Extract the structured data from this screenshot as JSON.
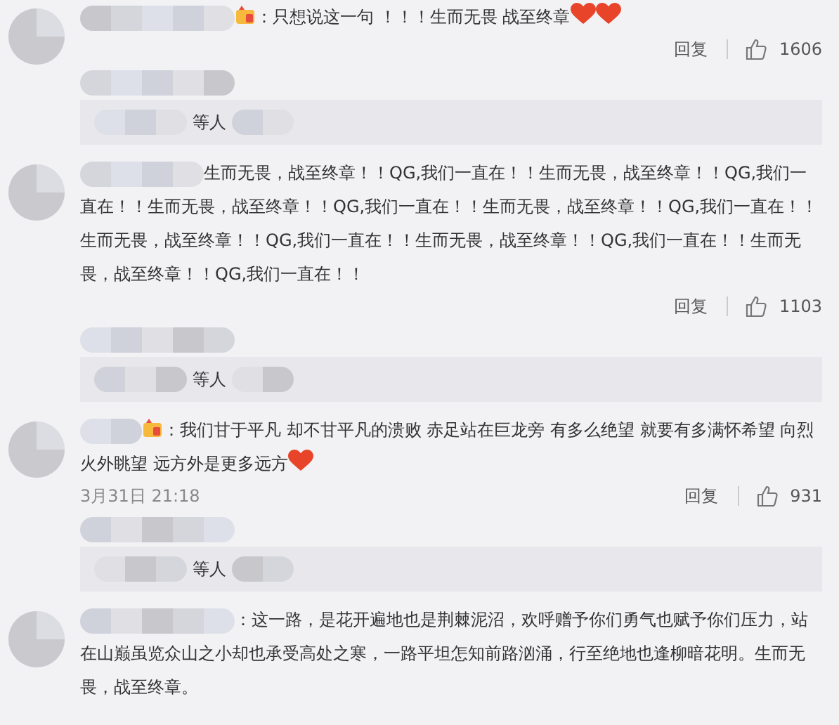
{
  "comments": [
    {
      "author_badge": true,
      "text": "：只想说这一句 ！！！生而无畏 战至终章",
      "trailing_icons": [
        {
          "kind": "heart"
        },
        {
          "kind": "heart"
        }
      ],
      "reply_label": "回复",
      "likes": "1606",
      "replies_summary": "等人"
    },
    {
      "author_badge": false,
      "text": "生而无畏，战至终章！！QG,我们一直在！！生而无畏，战至终章！！QG,我们一直在！！生而无畏，战至终章！！QG,我们一直在！！生而无畏，战至终章！！QG,我们一直在！！生而无畏，战至终章！！QG,我们一直在！！生而无畏，战至终章！！QG,我们一直在！！生而无畏，战至终章！！QG,我们一直在！！",
      "reply_label": "回复",
      "likes": "1103",
      "replies_summary": "等人"
    },
    {
      "author_badge": true,
      "text": "：我们甘于平凡 却不甘平凡的溃败 赤足站在巨龙旁 有多么绝望 就要有多满怀希望 向烈火外眺望 远方外是更多远方",
      "trailing_icons": [
        {
          "kind": "heart"
        }
      ],
      "time": "3月31日 21:18",
      "reply_label": "回复",
      "likes": "931",
      "replies_summary": "等人"
    },
    {
      "author_badge": false,
      "text": "：这一路，是花开遍地也是荆棘泥沼，欢呼赠予你们勇气也赋予你们压力，站在山巅虽览众山之小却也承受高处之寒，一路平坦怎知前路汹涌，行至绝地也逢柳暗花明。生而无畏，战至终章。"
    }
  ]
}
